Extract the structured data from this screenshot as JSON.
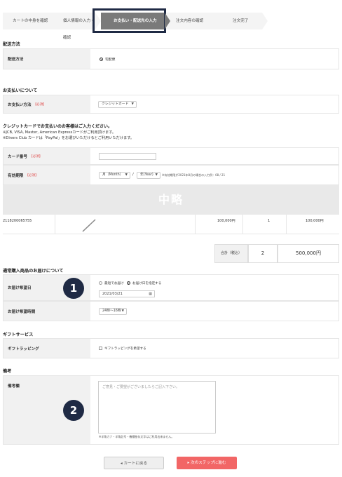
{
  "steps": [
    "カートの中身を確認",
    "個人情報の入力・確認",
    "お支払い・配送先の入力",
    "注文内容の確認",
    "注文完了"
  ],
  "delivery": {
    "section_title": "配送方法",
    "label": "配送方法",
    "option": "宅配便"
  },
  "payment": {
    "section_title": "お支払いについて",
    "label": "お支払い方法",
    "required": "【必須】",
    "select_value": "クレジットカード"
  },
  "card": {
    "heading": "クレジットカードでお支払いのお客様はご入力ください。",
    "note1": "※JCB, VISA, Master, American Expressカードがご利用頂けます。",
    "note2": "※Diners Club カードは「PayPal」をお選びいただけるとご利用いただけます。",
    "number_label": "カード番号",
    "expiry_label": "有効期限",
    "month_select": "月（Month）",
    "separator": "/",
    "year_select": "年(Year)",
    "expiry_note": "※有効期限が2021年8月の場合の入力例：08 / 21"
  },
  "omitted_label": "中略",
  "product_row": {
    "code": "2118200065755",
    "price": "100,000円",
    "qty": "1",
    "subtotal": "100,000円"
  },
  "totals": {
    "label": "合計（税込）",
    "qty": "2",
    "amount": "500,000円"
  },
  "regular_delivery": {
    "section_title": "通常購入商品のお届けについて",
    "date_label": "お届け希望日",
    "option_earliest": "最短でお届け",
    "option_specify": "お届け日を指定する",
    "date_value": "2021/03/21",
    "time_label": "お届け希望時間",
    "time_value": "24時〜16時"
  },
  "gift": {
    "section_title": "ギフトサービス",
    "label": "ギフトラッピング",
    "option": "ギフトラッピングを希望する"
  },
  "remarks": {
    "section_title": "備考",
    "label": "備考欄",
    "placeholder": "ご意見・ご要望がございましたらご記入下さい。",
    "note": "※半角カナ・半角記号・機種依存文字はご利用出来ません。"
  },
  "badges": [
    "1",
    "2"
  ],
  "buttons": {
    "back": "カートに戻る",
    "next": "次のステップに進む"
  },
  "colors": {
    "badge": "#1f2a44",
    "next_button": "#f26666",
    "required": "#e0504f",
    "active_step": "#7a7a7a"
  },
  "icons": [
    "calendar-icon",
    "chevron-left-icon",
    "chevron-right-icon",
    "chevron-down-icon"
  ]
}
